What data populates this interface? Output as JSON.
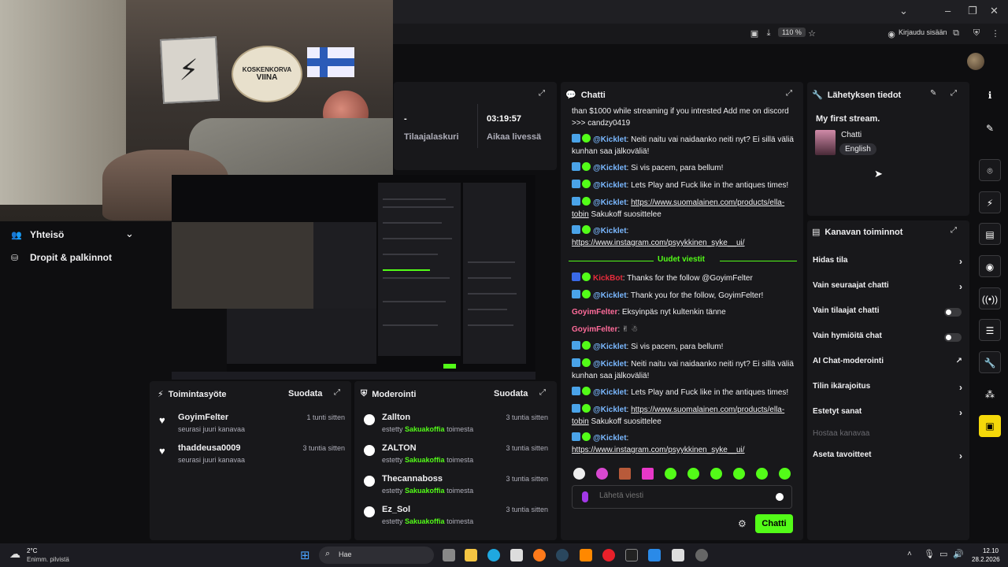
{
  "browser": {
    "zoom": "110 %",
    "login_label": "Kirjaudu sisään"
  },
  "sidebar": {
    "community_label": "Yhteisö",
    "drops_label": "Dropit & palkinnot"
  },
  "stats": {
    "subscribers_value": "-",
    "subscribers_label": "Tilaajalaskuri",
    "uptime_value": "03:19:57",
    "uptime_label": "Aikaa livessä"
  },
  "activity": {
    "title": "Toimintasyöte",
    "filter_label": "Suodata",
    "items": [
      {
        "name": "GoyimFelter",
        "sub": "seurasi juuri kanavaa",
        "time": "1 tunti sitten"
      },
      {
        "name": "thaddeusa0009",
        "sub": "seurasi juuri kanavaa",
        "time": "3 tuntia sitten"
      }
    ]
  },
  "moderation": {
    "title": "Moderointi",
    "filter_label": "Suodata",
    "banned_prefix": "estetty",
    "banned_by": "Sakuakoffia",
    "banned_suffix": "toimesta",
    "items": [
      {
        "name": "Zallton",
        "time": "3 tuntia sitten"
      },
      {
        "name": "ZALTON",
        "time": "3 tuntia sitten"
      },
      {
        "name": "Thecannaboss",
        "time": "3 tuntia sitten"
      },
      {
        "name": "Ez_Sol",
        "time": "3 tuntia sitten"
      }
    ]
  },
  "chat": {
    "title": "Chatti",
    "new_messages_label": "Uudet viestit",
    "input_placeholder": "Lähetä viesti",
    "send_label": "Chatti",
    "m0": "than $1000 while streaming if you intrested Add me on discord >>> candzy0419",
    "kicklet": "@Kicklet",
    "kickbot": "KickBot",
    "goyim": "GoyimFelter",
    "m1": ": Neiti naitu vai naidaanko neiti nyt? Ei sillä väliä kunhan saa jälkoväliä!",
    "m2": ": Si vis pacem, para bellum!",
    "m3": ": Lets Play and Fuck like in the antiques times!",
    "m4_link": "https://www.suomalainen.com/products/ella-tobin",
    "m4_tail": " Sakukoff suosittelee",
    "m5_link": "https://www.instagram.com/psyykkinen_syke__ui/",
    "m6": ": Thanks for the follow @GoyimFelter",
    "m7": ": Thank you for the follow, GoyimFelter!",
    "m8": ": Eksyinpäs nyt kultenkin tänne",
    "m9": ":"
  },
  "stream_info": {
    "title": "Lähetyksen tiedot",
    "stream_title": "My first stream.",
    "category": "Chatti",
    "language": "English"
  },
  "channel_actions": {
    "title": "Kanavan toiminnot",
    "items": [
      {
        "label": "Hidas tila"
      },
      {
        "label": "Vain seuraajat chatti"
      },
      {
        "label": "Vain tilaajat chatti"
      },
      {
        "label": "Vain hymiöitä chat"
      },
      {
        "label": "AI Chat-moderointi"
      },
      {
        "label": "Tilin ikärajoitus"
      },
      {
        "label": "Estetyt sanat"
      },
      {
        "label": "Hostaa kanavaa"
      },
      {
        "label": "Aseta tavoitteet"
      }
    ]
  },
  "webcam": {
    "sign_line1": "KOSKENKORVA",
    "sign_line2": "VIINA"
  },
  "taskbar": {
    "temperature": "2°C",
    "weather_desc": "Enimm. pilvistä",
    "search_label": "Hae",
    "time": "12.10",
    "date": "28.2.2026"
  },
  "colors": {
    "accent_green": "#53fc18",
    "panel_bg": "#18181b",
    "page_bg": "#0e0e10"
  }
}
